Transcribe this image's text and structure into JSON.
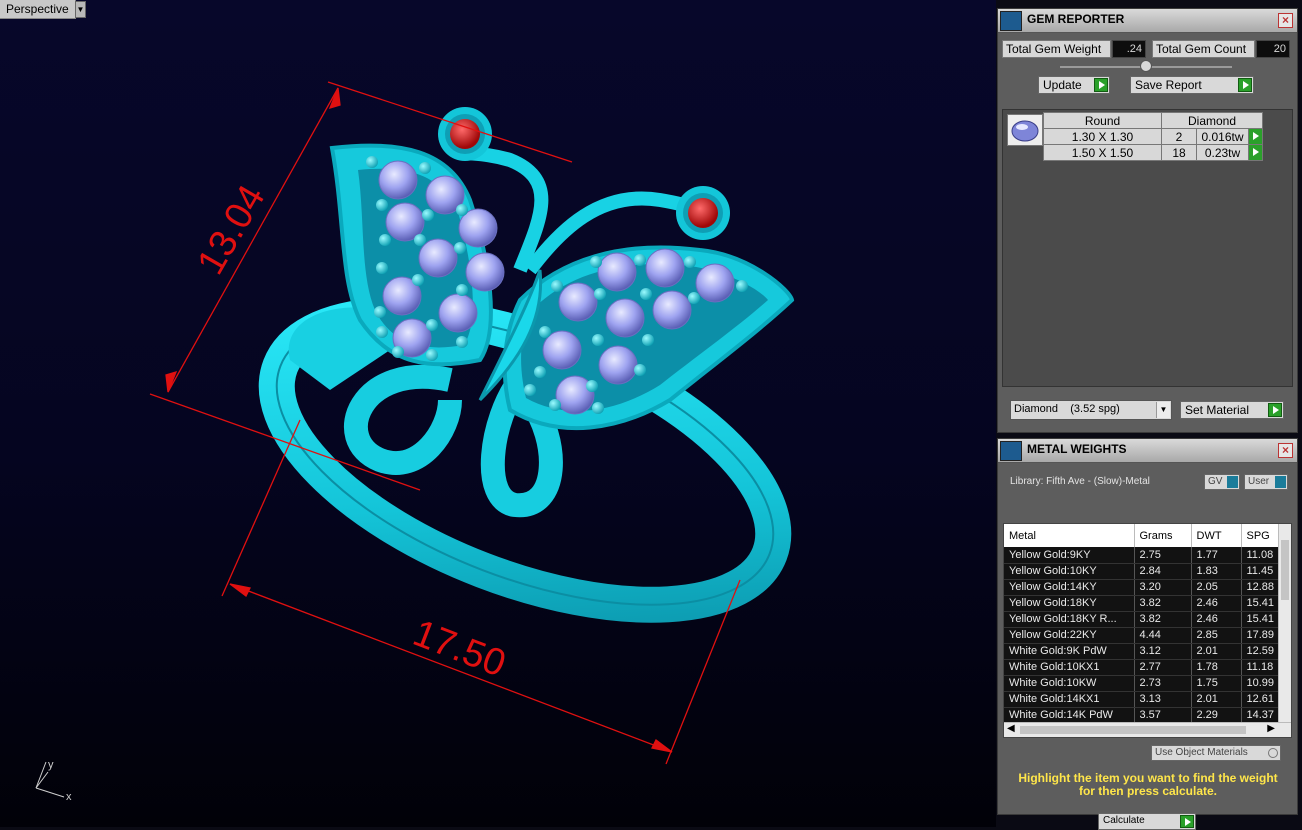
{
  "viewport": {
    "label": "Perspective",
    "dimension_vertical": "13.04",
    "dimension_horizontal": "17.50",
    "axis_y": "y",
    "axis_x": "x"
  },
  "gem_reporter": {
    "title": "GEM REPORTER",
    "total_weight_label": "Total Gem Weight",
    "total_weight_value": ".24",
    "total_count_label": "Total Gem Count",
    "total_count_value": "20",
    "update_label": "Update",
    "save_report_label": "Save Report",
    "shape_header": "Round",
    "type_header": "Diamond",
    "rows": [
      {
        "size": "1.30 X 1.30",
        "count": "2",
        "weight": "0.016tw"
      },
      {
        "size": "1.50 X 1.50",
        "count": "18",
        "weight": "0.23tw"
      }
    ],
    "material_select": "Diamond    (3.52 spg)",
    "set_material_label": "Set Material"
  },
  "metal_weights": {
    "title": "METAL WEIGHTS",
    "library": "Library: Fifth Ave - (Slow)-Metal",
    "gv_label": "GV",
    "user_label": "User",
    "columns": [
      "Metal",
      "Grams",
      "DWT",
      "SPG"
    ],
    "rows": [
      [
        "Yellow Gold:9KY",
        "2.75",
        "1.77",
        "11.08"
      ],
      [
        "Yellow Gold:10KY",
        "2.84",
        "1.83",
        "11.45"
      ],
      [
        "Yellow Gold:14KY",
        "3.20",
        "2.05",
        "12.88"
      ],
      [
        "Yellow Gold:18KY",
        "3.82",
        "2.46",
        "15.41"
      ],
      [
        "Yellow Gold:18KY R...",
        "3.82",
        "2.46",
        "15.41"
      ],
      [
        "Yellow Gold:22KY",
        "4.44",
        "2.85",
        "17.89"
      ],
      [
        "White Gold:9K PdW",
        "3.12",
        "2.01",
        "12.59"
      ],
      [
        "White Gold:10KX1",
        "2.77",
        "1.78",
        "11.18"
      ],
      [
        "White Gold:10KW",
        "2.73",
        "1.75",
        "10.99"
      ],
      [
        "White Gold:14KX1",
        "3.13",
        "2.01",
        "12.61"
      ],
      [
        "White Gold:14K PdW",
        "3.57",
        "2.29",
        "14.37"
      ]
    ],
    "use_object_materials": "Use Object Materials",
    "hint": "Highlight the item you want to find the weight for then press calculate.",
    "calculate_label": "Calculate"
  },
  "colors": {
    "ring": "#19d6e6",
    "ruby": "#d11a1a",
    "diamond": "#9aa0f0",
    "dimension": "#e01010"
  }
}
